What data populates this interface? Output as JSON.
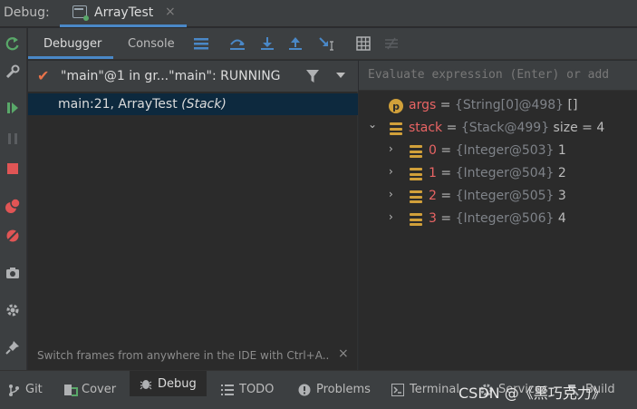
{
  "titlebar": {
    "label": "Debug:",
    "tab_title": "ArrayTest",
    "tab_close": "×"
  },
  "left_toolbar": {
    "icons": [
      "rerun-icon",
      "wrench-icon",
      "resume-icon",
      "pause-icon",
      "stop-icon",
      "view-breakpoints-icon",
      "mute-breakpoints-icon",
      "camera-icon",
      "settings-icon",
      "pin-icon"
    ]
  },
  "debugger_toolbar": {
    "tabs": [
      "Debugger",
      "Console"
    ],
    "icons": [
      "layout-icon",
      "step-over-icon",
      "step-into-icon",
      "step-out-icon",
      "run-to-cursor-icon",
      "evaluate-icon",
      "trace-icon"
    ]
  },
  "frames": {
    "thread": "\"main\"@1 in gr...\"main\": RUNNING",
    "frame_location": "main:21, ArrayTest ",
    "frame_stack": "(Stack)",
    "hint": "Switch frames from anywhere in the IDE with Ctrl+A..",
    "hint_close": "×"
  },
  "variables": {
    "evaluate_placeholder": "Evaluate expression (Enter) or add",
    "rows": [
      {
        "name": "args",
        "eq": " = ",
        "ref": "{String[0]@498}",
        "value": " []"
      },
      {
        "name": "stack",
        "eq": " = ",
        "ref": "{Stack@499}",
        "value": "  size = 4"
      },
      {
        "name": "0",
        "eq": " = ",
        "ref": "{Integer@503}",
        "value": " 1"
      },
      {
        "name": "1",
        "eq": " = ",
        "ref": "{Integer@504}",
        "value": " 2"
      },
      {
        "name": "2",
        "eq": " = ",
        "ref": "{Integer@505}",
        "value": " 3"
      },
      {
        "name": "3",
        "eq": " = ",
        "ref": "{Integer@506}",
        "value": " 4"
      }
    ],
    "param_badge": "p",
    "expand_arrow": "›",
    "expanded_arrow": "⌄"
  },
  "bottom_bar": {
    "items": [
      "Git",
      "Cover",
      "Debug",
      "TODO",
      "Problems",
      "Terminal",
      "Services",
      "Build"
    ]
  },
  "watermark": "CSDN @《黑巧克力》",
  "colors": {
    "accent": "#4a88c7",
    "selection": "#0d293e",
    "field_icon": "#d1a03a",
    "name_red": "#e96464",
    "resume_green": "#59a869",
    "stop_red": "#e05555"
  }
}
